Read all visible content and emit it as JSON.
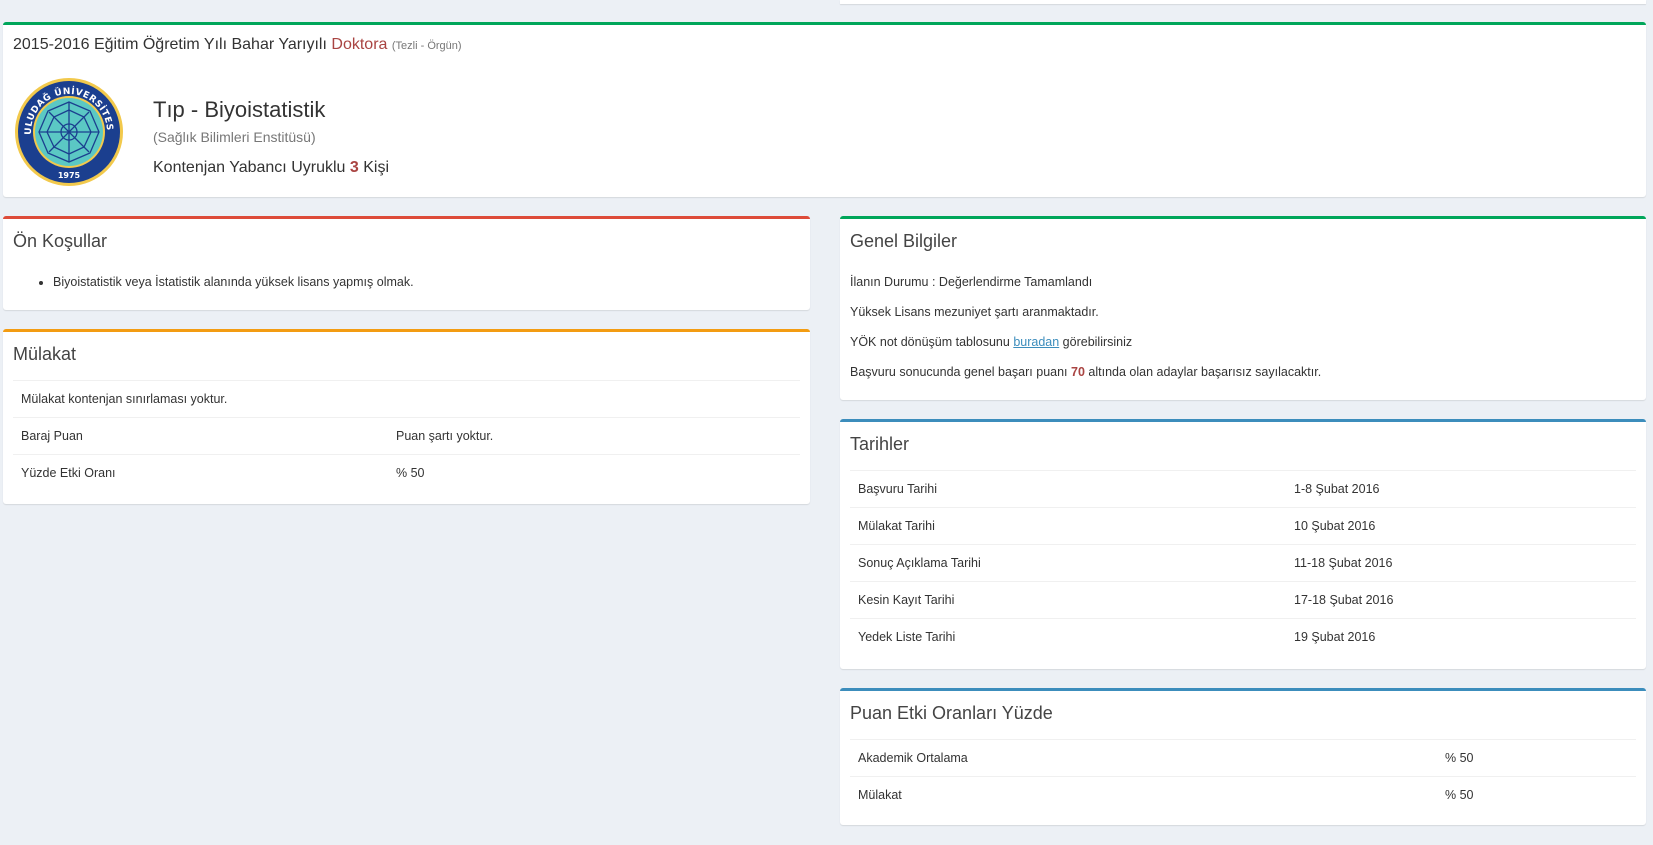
{
  "header": {
    "period": "2015-2016 Eğitim Öğretim Yılı Bahar Yarıyılı",
    "degree": "Doktora",
    "degree_type": "(Tezli - Örgün)",
    "program": "Tıp - Biyoistatistik",
    "institute": "(Sağlık Bilimleri Enstitüsü)",
    "quota_prefix": "Kontenjan Yabancı Uyruklu",
    "quota_count": "3",
    "quota_suffix": "Kişi",
    "logo_text_top": "ULUDAĞ ÜNİVERSİTESİ",
    "logo_year": "1975"
  },
  "prerequisites": {
    "title": "Ön Koşullar",
    "items": [
      "Biyoistatistik veya İstatistik alanında yüksek lisans yapmış olmak."
    ]
  },
  "interview": {
    "title": "Mülakat",
    "note": "Mülakat kontenjan sınırlaması yoktur.",
    "rows": [
      {
        "label": "Baraj Puan",
        "value": "Puan şartı yoktur."
      },
      {
        "label": "Yüzde Etki Oranı",
        "value": "% 50"
      }
    ]
  },
  "general": {
    "title": "Genel Bilgiler",
    "status": "İlanın Durumu : Değerlendirme Tamamlandı",
    "requirement": "Yüksek Lisans mezuniyet şartı aranmaktadır.",
    "yok_prefix": "YÖK not dönüşüm tablosunu",
    "yok_link": "buradan",
    "yok_suffix": "görebilirsiniz",
    "fail_prefix": "Başvuru sonucunda genel başarı puanı",
    "fail_score": "70",
    "fail_suffix": "altında olan adaylar başarısız sayılacaktır."
  },
  "dates": {
    "title": "Tarihler",
    "rows": [
      {
        "label": "Başvuru Tarihi",
        "value": "1-8 Şubat 2016"
      },
      {
        "label": "Mülakat Tarihi",
        "value": "10 Şubat 2016"
      },
      {
        "label": "Sonuç Açıklama Tarihi",
        "value": "11-18 Şubat 2016"
      },
      {
        "label": "Kesin Kayıt Tarihi",
        "value": "17-18 Şubat 2016"
      },
      {
        "label": "Yedek Liste Tarihi",
        "value": "19 Şubat 2016"
      }
    ]
  },
  "weights": {
    "title": "Puan Etki Oranları Yüzde",
    "rows": [
      {
        "label": "Akademik Ortalama",
        "value": "% 50"
      },
      {
        "label": "Mülakat",
        "value": "% 50"
      }
    ]
  },
  "colors": {
    "green": "#00a65a",
    "red": "#dd4b39",
    "orange": "#f39c12",
    "blue": "#3c8dbc",
    "emphasis": "#a94442"
  }
}
